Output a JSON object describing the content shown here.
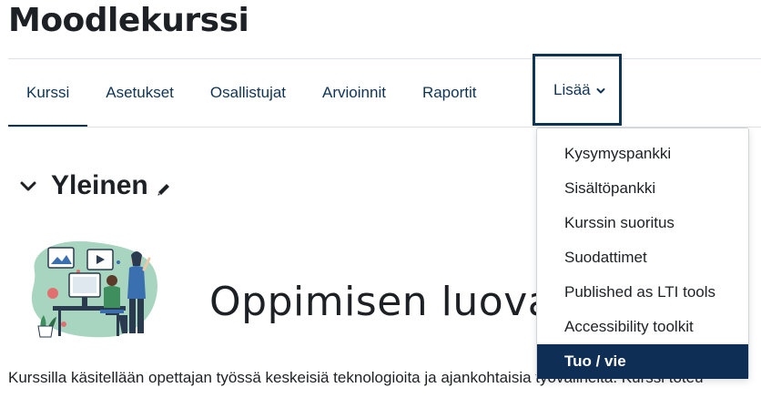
{
  "course": {
    "title": "Moodlekurssi"
  },
  "tabs": [
    {
      "label": "Kurssi",
      "active": true
    },
    {
      "label": "Asetukset"
    },
    {
      "label": "Osallistujat"
    },
    {
      "label": "Arvioinnit"
    },
    {
      "label": "Raportit"
    }
  ],
  "more_tab": {
    "label": "Lisää",
    "icon": "chevron-down-icon"
  },
  "more_menu": {
    "items": [
      {
        "label": "Kysymyspankki"
      },
      {
        "label": "Sisältöpankki"
      },
      {
        "label": "Kurssin suoritus"
      },
      {
        "label": "Suodattimet"
      },
      {
        "label": "Published as LTI tools"
      },
      {
        "label": "Accessibility toolkit"
      },
      {
        "label": "Tuo / vie",
        "selected": true
      }
    ]
  },
  "section": {
    "title": "Yleinen",
    "collapse_icon": "chevron-down-icon",
    "edit_icon": "pencil-icon"
  },
  "banner": {
    "text": "Oppimisen luovat"
  },
  "description": {
    "text": "Kurssilla käsitellään opettajan työssä keskeisiä teknologioita ja ajankohtaisia työvälineitä. Kurssi toteu"
  },
  "colors": {
    "primary_dark": "#0f3456",
    "selected_bg": "#0f2e55",
    "text": "#1d2125",
    "illustration_green": "#a8d5bf",
    "illustration_blue": "#3a6fb0"
  }
}
